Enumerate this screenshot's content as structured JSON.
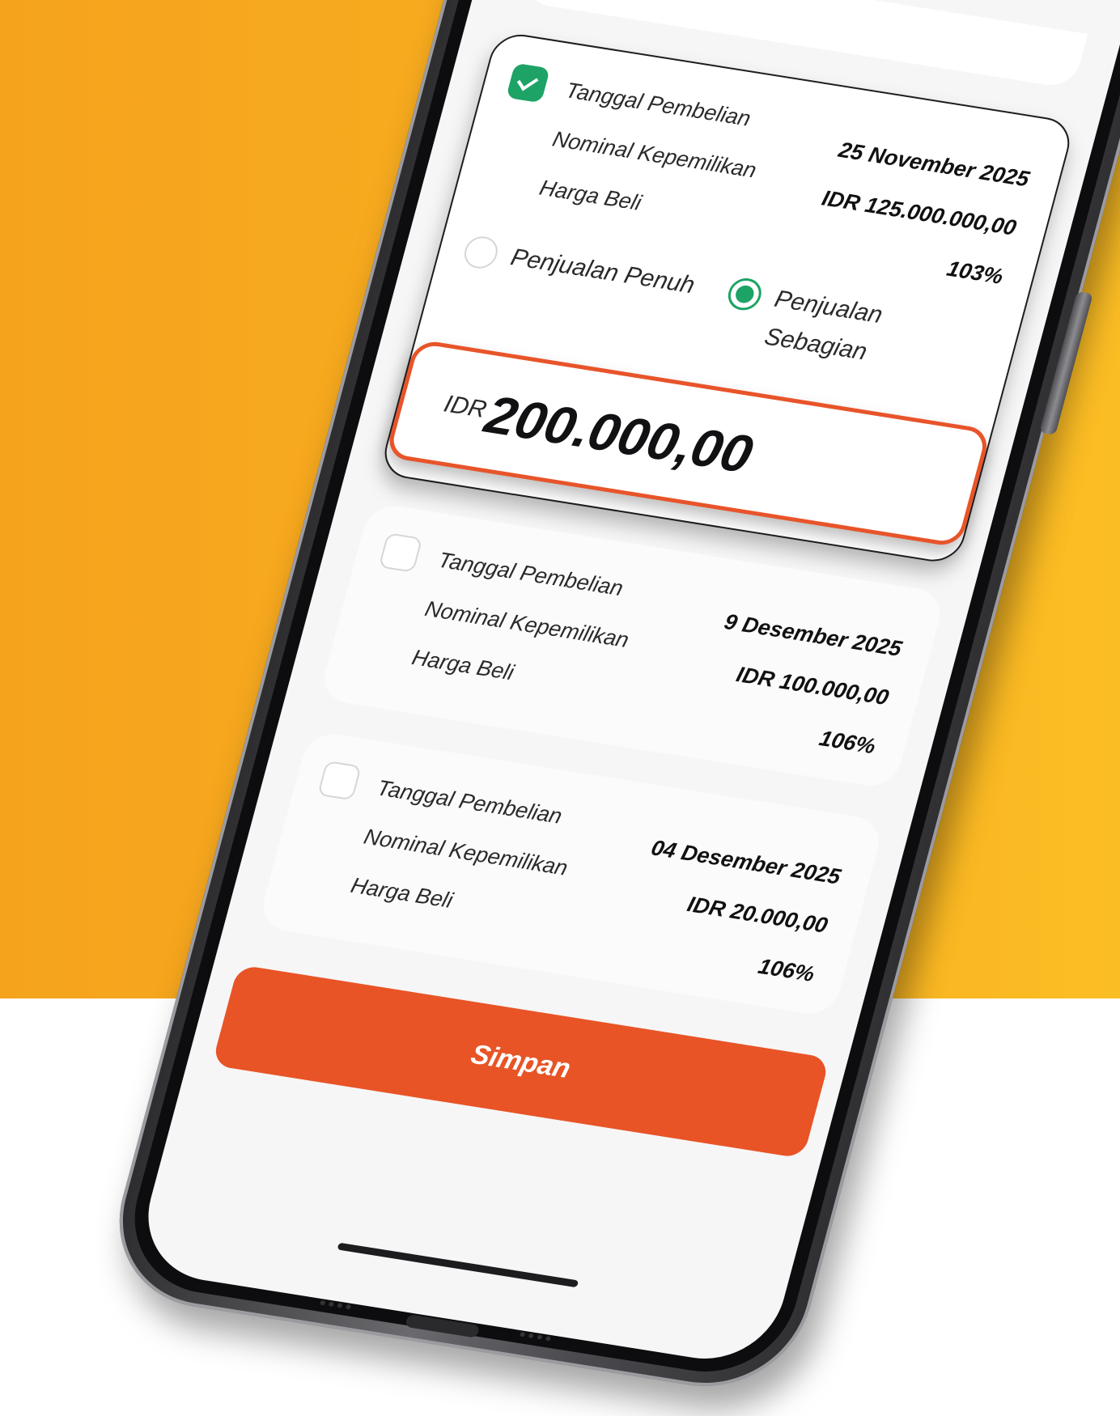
{
  "holdings": [
    {
      "checked": true,
      "labels": {
        "date": "Tanggal Pembelian",
        "amount": "Nominal Kepemilikan",
        "price": "Harga Beli"
      },
      "date": "25 November 2025",
      "amount": "IDR 125.000.000,00",
      "price": "103%"
    },
    {
      "checked": false,
      "labels": {
        "date": "Tanggal Pembelian",
        "amount": "Nominal Kepemilikan",
        "price": "Harga Beli"
      },
      "date": "9 Desember 2025",
      "amount": "IDR 100.000,00",
      "price": "106%"
    },
    {
      "checked": false,
      "labels": {
        "date": "Tanggal Pembelian",
        "amount": "Nominal Kepemilikan",
        "price": "Harga Beli"
      },
      "date": "04 Desember 2025",
      "amount": "IDR 20.000,00",
      "price": "106%"
    }
  ],
  "sale_options": {
    "full": "Penjualan Penuh",
    "partial": "Penjualan Sebagian",
    "selected": "partial"
  },
  "sale_amount": {
    "currency": "IDR",
    "value": "200.000,00"
  },
  "save_label": "Simpan",
  "colors": {
    "accent": "#e85426",
    "success": "#1ea366",
    "background": "#f8ae1f"
  }
}
